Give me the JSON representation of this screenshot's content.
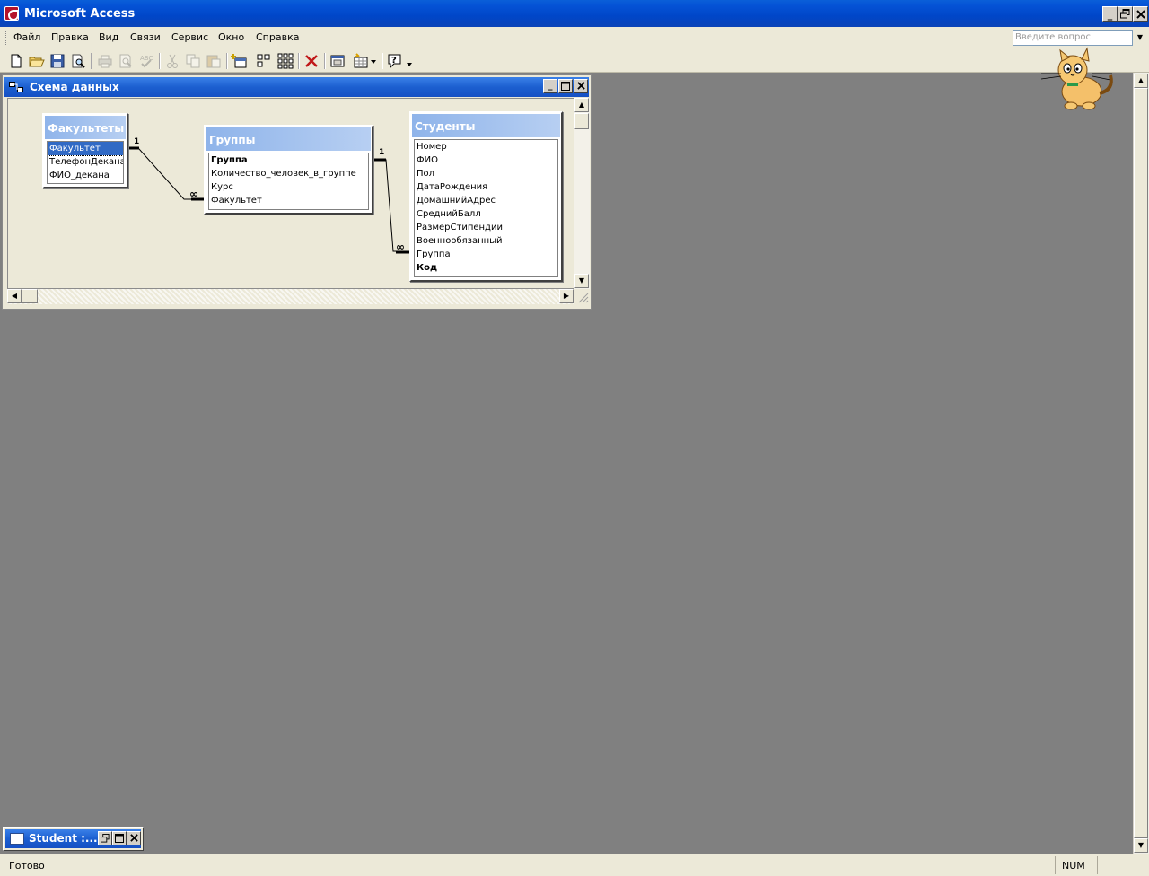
{
  "app": {
    "title": "Microsoft Access",
    "caption_buttons": {
      "minimize": "_",
      "restore": "❐",
      "close": "✕"
    }
  },
  "menu": {
    "items": [
      {
        "label": "Файл"
      },
      {
        "label": "Правка"
      },
      {
        "label": "Вид"
      },
      {
        "label": "Связи"
      },
      {
        "label": "Сервис"
      },
      {
        "label": "Окно"
      },
      {
        "label": "Справка"
      }
    ],
    "ask_placeholder": "Введите вопрос"
  },
  "toolbar": {
    "buttons": [
      "new-icon",
      "open-icon",
      "save-icon",
      "search-icon",
      "print-icon",
      "print-preview-icon",
      "spelling-icon",
      "cut-icon",
      "copy-icon",
      "paste-icon",
      "show-table-icon",
      "show-direct-icon",
      "show-all-icon",
      "delete-icon",
      "new-object-icon",
      "object-menu-icon",
      "help-icon"
    ]
  },
  "relationship_window": {
    "title": "Схема данных",
    "tables": [
      {
        "name": "Факультеты",
        "fields": [
          {
            "label": "Факультет",
            "key": false,
            "selected": true
          },
          {
            "label": "ТелефонДекана",
            "key": false,
            "selected": false
          },
          {
            "label": "ФИО_декана",
            "key": false,
            "selected": false
          }
        ]
      },
      {
        "name": "Группы",
        "fields": [
          {
            "label": "Группа",
            "key": true,
            "selected": false
          },
          {
            "label": "Количество_человек_в_группе",
            "key": false,
            "selected": false
          },
          {
            "label": "Курс",
            "key": false,
            "selected": false
          },
          {
            "label": "Факультет",
            "key": false,
            "selected": false
          }
        ]
      },
      {
        "name": "Студенты",
        "fields": [
          {
            "label": "Номер",
            "key": false,
            "selected": false
          },
          {
            "label": "ФИО",
            "key": false,
            "selected": false
          },
          {
            "label": "Пол",
            "key": false,
            "selected": false
          },
          {
            "label": "ДатаРождения",
            "key": false,
            "selected": false
          },
          {
            "label": "ДомашнийАдрес",
            "key": false,
            "selected": false
          },
          {
            "label": "СреднийБалл",
            "key": false,
            "selected": false
          },
          {
            "label": "РазмерСтипендии",
            "key": false,
            "selected": false
          },
          {
            "label": "Военнообязанный",
            "key": false,
            "selected": false
          },
          {
            "label": "Группа",
            "key": false,
            "selected": false
          },
          {
            "label": "Код",
            "key": true,
            "selected": false
          }
        ]
      }
    ],
    "relations": [
      {
        "from_mark": "1",
        "to_mark": "∞"
      },
      {
        "from_mark": "1",
        "to_mark": "∞"
      }
    ]
  },
  "minimized_window": {
    "title": "Student :..."
  },
  "status": {
    "text": "Готово",
    "num": "NUM"
  }
}
